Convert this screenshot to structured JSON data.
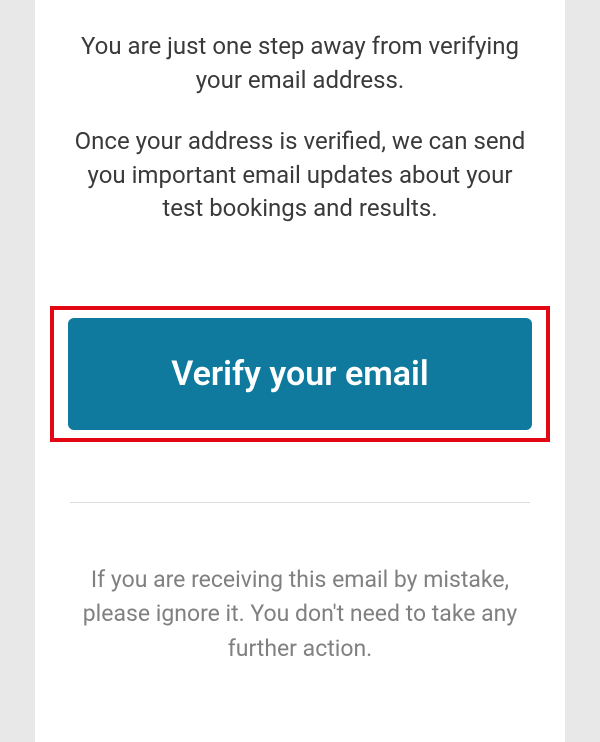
{
  "intro": "You are just one step away from verifying your email address.",
  "detail": "Once your address is verified, we can send you important email updates about your test bookings and results.",
  "button_label": "Verify your email",
  "footer": "If you are receiving this email by mistake, please ignore it. You don't need to take any further action."
}
